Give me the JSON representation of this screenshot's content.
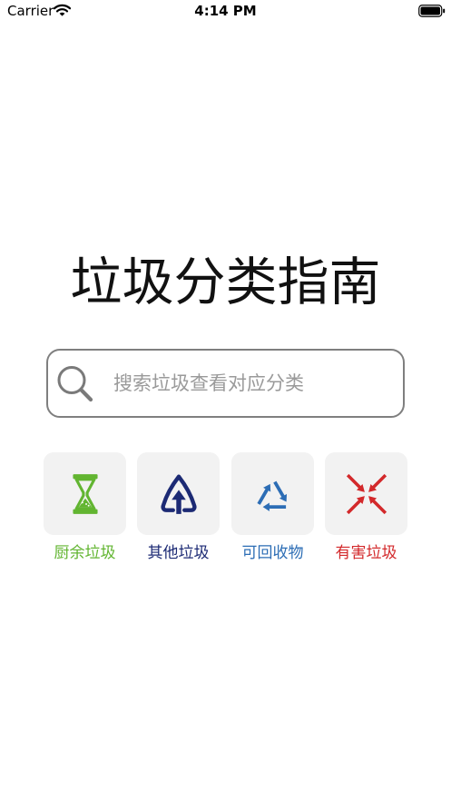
{
  "status_bar": {
    "carrier": "Carrier",
    "time": "4:14 PM",
    "icons": [
      "wifi-icon",
      "battery-icon"
    ]
  },
  "title": "垃圾分类指南",
  "search": {
    "placeholder": "搜索垃圾查看对应分类",
    "value": "",
    "icon": "search-icon"
  },
  "categories": [
    {
      "label": "厨余垃圾",
      "icon": "kitchen-waste-icon",
      "color": "#62b531"
    },
    {
      "label": "其他垃圾",
      "icon": "other-waste-icon",
      "color": "#1c2a74"
    },
    {
      "label": "可回收物",
      "icon": "recyclable-icon",
      "color": "#2c6db5"
    },
    {
      "label": "有害垃圾",
      "icon": "hazardous-waste-icon",
      "color": "#d3292b"
    }
  ]
}
